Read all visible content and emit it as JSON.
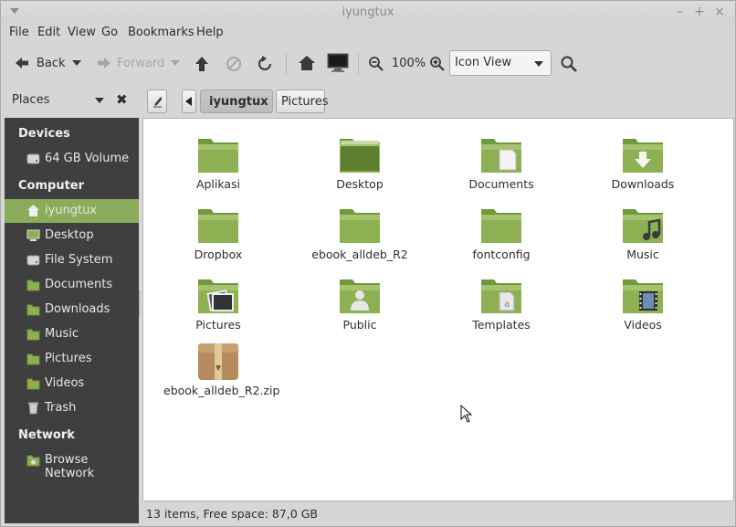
{
  "window": {
    "title": "iyungtux"
  },
  "menubar": [
    "File",
    "Edit",
    "View",
    "Go",
    "Bookmarks",
    "Help"
  ],
  "toolbar": {
    "back_label": "Back",
    "forward_label": "Forward",
    "zoom_level": "100%",
    "view_mode": "Icon View"
  },
  "sidebar": {
    "header_label": "Places",
    "sections": [
      {
        "title": "Devices",
        "items": [
          {
            "label": "64 GB Volume",
            "icon": "drive-icon"
          }
        ]
      },
      {
        "title": "Computer",
        "items": [
          {
            "label": "iyungtux",
            "icon": "home-icon",
            "selected": true
          },
          {
            "label": "Desktop",
            "icon": "desktop-icon"
          },
          {
            "label": "File System",
            "icon": "drive-icon"
          },
          {
            "label": "Documents",
            "icon": "folder-icon"
          },
          {
            "label": "Downloads",
            "icon": "folder-icon"
          },
          {
            "label": "Music",
            "icon": "folder-icon"
          },
          {
            "label": "Pictures",
            "icon": "folder-icon"
          },
          {
            "label": "Videos",
            "icon": "folder-icon"
          },
          {
            "label": "Trash",
            "icon": "trash-icon"
          }
        ]
      },
      {
        "title": "Network",
        "items": [
          {
            "label": "Browse Network",
            "icon": "network-icon"
          }
        ]
      }
    ]
  },
  "pathbar": {
    "crumbs": [
      "iyungtux",
      "Pictures"
    ]
  },
  "files": [
    {
      "name": "Aplikasi",
      "kind": "folder"
    },
    {
      "name": "Desktop",
      "kind": "desktop"
    },
    {
      "name": "Documents",
      "kind": "documents"
    },
    {
      "name": "Downloads",
      "kind": "downloads"
    },
    {
      "name": "Dropbox",
      "kind": "folder"
    },
    {
      "name": "ebook_alldeb_R2",
      "kind": "folder"
    },
    {
      "name": "fontconfig",
      "kind": "folder"
    },
    {
      "name": "Music",
      "kind": "music"
    },
    {
      "name": "Pictures",
      "kind": "pictures"
    },
    {
      "name": "Public",
      "kind": "public"
    },
    {
      "name": "Templates",
      "kind": "templates"
    },
    {
      "name": "Videos",
      "kind": "videos"
    },
    {
      "name": "ebook_alldeb_R2.zip",
      "kind": "archive"
    }
  ],
  "status": {
    "text": "13 items, Free space: 87,0 GB"
  },
  "colors": {
    "accent": "#8bac5a",
    "sidebar_bg": "#3f3f3f",
    "folder": "#8db052"
  }
}
